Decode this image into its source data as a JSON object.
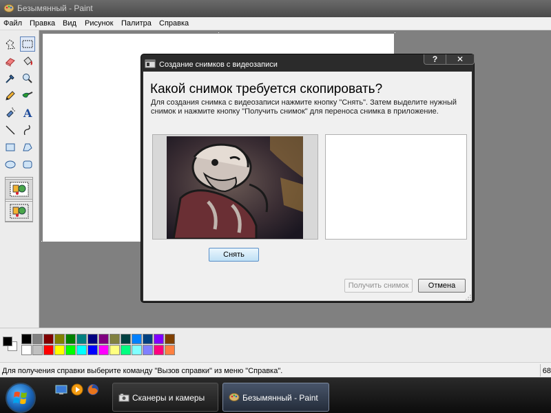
{
  "window": {
    "title": "Безымянный - Paint"
  },
  "menu": {
    "items": [
      "Файл",
      "Правка",
      "Вид",
      "Рисунок",
      "Палитра",
      "Справка"
    ]
  },
  "toolbox": {
    "tools": [
      "free-select",
      "rect-select",
      "eraser",
      "fill",
      "color-picker",
      "magnifier",
      "pencil",
      "brush",
      "airbrush",
      "text",
      "line",
      "curve",
      "rectangle",
      "polygon",
      "ellipse",
      "rounded-rectangle"
    ],
    "selected": "rect-select",
    "selection_modes": [
      "opaque",
      "transparent"
    ]
  },
  "palette": {
    "foreground": "#000000",
    "background": "#FFFFFF",
    "row1": [
      "#000000",
      "#808080",
      "#800000",
      "#808000",
      "#008000",
      "#008080",
      "#000080",
      "#800080",
      "#808040",
      "#004040",
      "#0080FF",
      "#004080",
      "#8000FF",
      "#804000"
    ],
    "row2": [
      "#FFFFFF",
      "#C0C0C0",
      "#FF0000",
      "#FFFF00",
      "#00FF00",
      "#00FFFF",
      "#0000FF",
      "#FF00FF",
      "#FFFF80",
      "#00FF80",
      "#80FFFF",
      "#8080FF",
      "#FF0080",
      "#FF8040"
    ]
  },
  "status": {
    "text": "Для получения справки выберите команду \"Вызов справки\" из меню \"Справка\".",
    "right": "68"
  },
  "dialog": {
    "title": "Создание снимков с видеозаписи",
    "help_label": "?",
    "close_label": "✕",
    "heading": "Какой снимок требуется скопировать?",
    "description": "Для создания снимка с видеозаписи нажмите кнопку \"Снять\".  Затем выделите нужный снимок и нажмите кнопку \"Получить снимок\" для переноса снимка в приложение.",
    "snap_button": "Снять",
    "get_button": "Получить снимок",
    "cancel_button": "Отмена"
  },
  "taskbar": {
    "quick_launch": [
      "show-desktop",
      "media-player",
      "firefox"
    ],
    "tasks": [
      {
        "label": "Сканеры и камеры",
        "active": false
      },
      {
        "label": "Безымянный - Paint",
        "active": true
      }
    ]
  }
}
